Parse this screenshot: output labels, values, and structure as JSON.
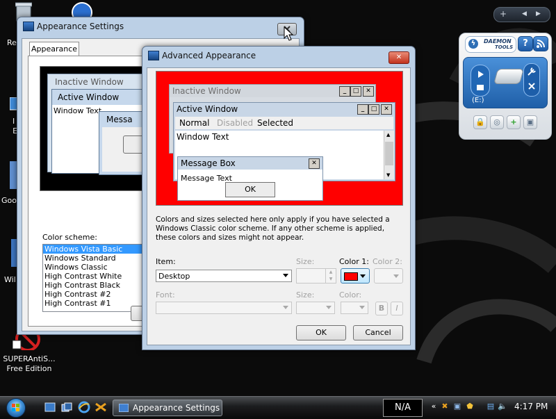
{
  "desktop": {
    "icons": [
      {
        "label": "Re"
      },
      {
        "label": "I   \nEx"
      },
      {
        "label": "Goo"
      },
      {
        "label": "Wil"
      },
      {
        "label": "SUPERAntiS...\nFree Edition"
      }
    ]
  },
  "sidebar_gadget": {
    "add_symbol": "+",
    "prev_symbol": "◀",
    "next_symbol": "▶"
  },
  "daemon": {
    "logo_line1": "DAEMON",
    "logo_line2": "TOOLS",
    "help_symbol": "?",
    "rss_symbol": "☰",
    "drive_label": "(E:)"
  },
  "appearance_settings": {
    "title": "Appearance Settings",
    "tab_appearance": "Appearance",
    "preview": {
      "inactive_window": "Inactive Window",
      "active_window": "Active Window",
      "window_text": "Window Text",
      "message": "Messa"
    },
    "color_scheme_label": "Color scheme:",
    "schemes": [
      "Windows Vista Basic",
      "Windows Standard",
      "Windows Classic",
      "High Contrast White",
      "High Contrast Black",
      "High Contrast #2",
      "High Contrast #1"
    ],
    "selected_scheme": "Windows Vista Basic"
  },
  "advanced": {
    "title": "Advanced Appearance",
    "close_symbol": "✕",
    "preview": {
      "inactive_window": "Inactive Window",
      "active_window": "Active Window",
      "menu_normal": "Normal",
      "menu_disabled": "Disabled",
      "menu_selected": "Selected",
      "window_text": "Window Text",
      "message_box": "Message Box",
      "message_text": "Message Text",
      "ok": "OK"
    },
    "info_text": "Colors and sizes selected here only apply if you have selected a Windows Classic color scheme. If any other scheme is applied, these colors and sizes might not appear.",
    "item_label": "Item:",
    "item_value": "Desktop",
    "size_label": "Size:",
    "color1_label": "Color 1:",
    "color1_value": "#ff0000",
    "color2_label": "Color 2:",
    "font_label": "Font:",
    "font_size_label": "Size:",
    "font_color_label": "Color:",
    "bold_label": "B",
    "italic_label": "I",
    "ok_label": "OK",
    "cancel_label": "Cancel",
    "desktop_color": "#ff0000"
  },
  "taskbar": {
    "task_label": "Appearance Settings",
    "na_label": "N/A",
    "clock": "4:17 PM",
    "tray_expand": "«"
  }
}
